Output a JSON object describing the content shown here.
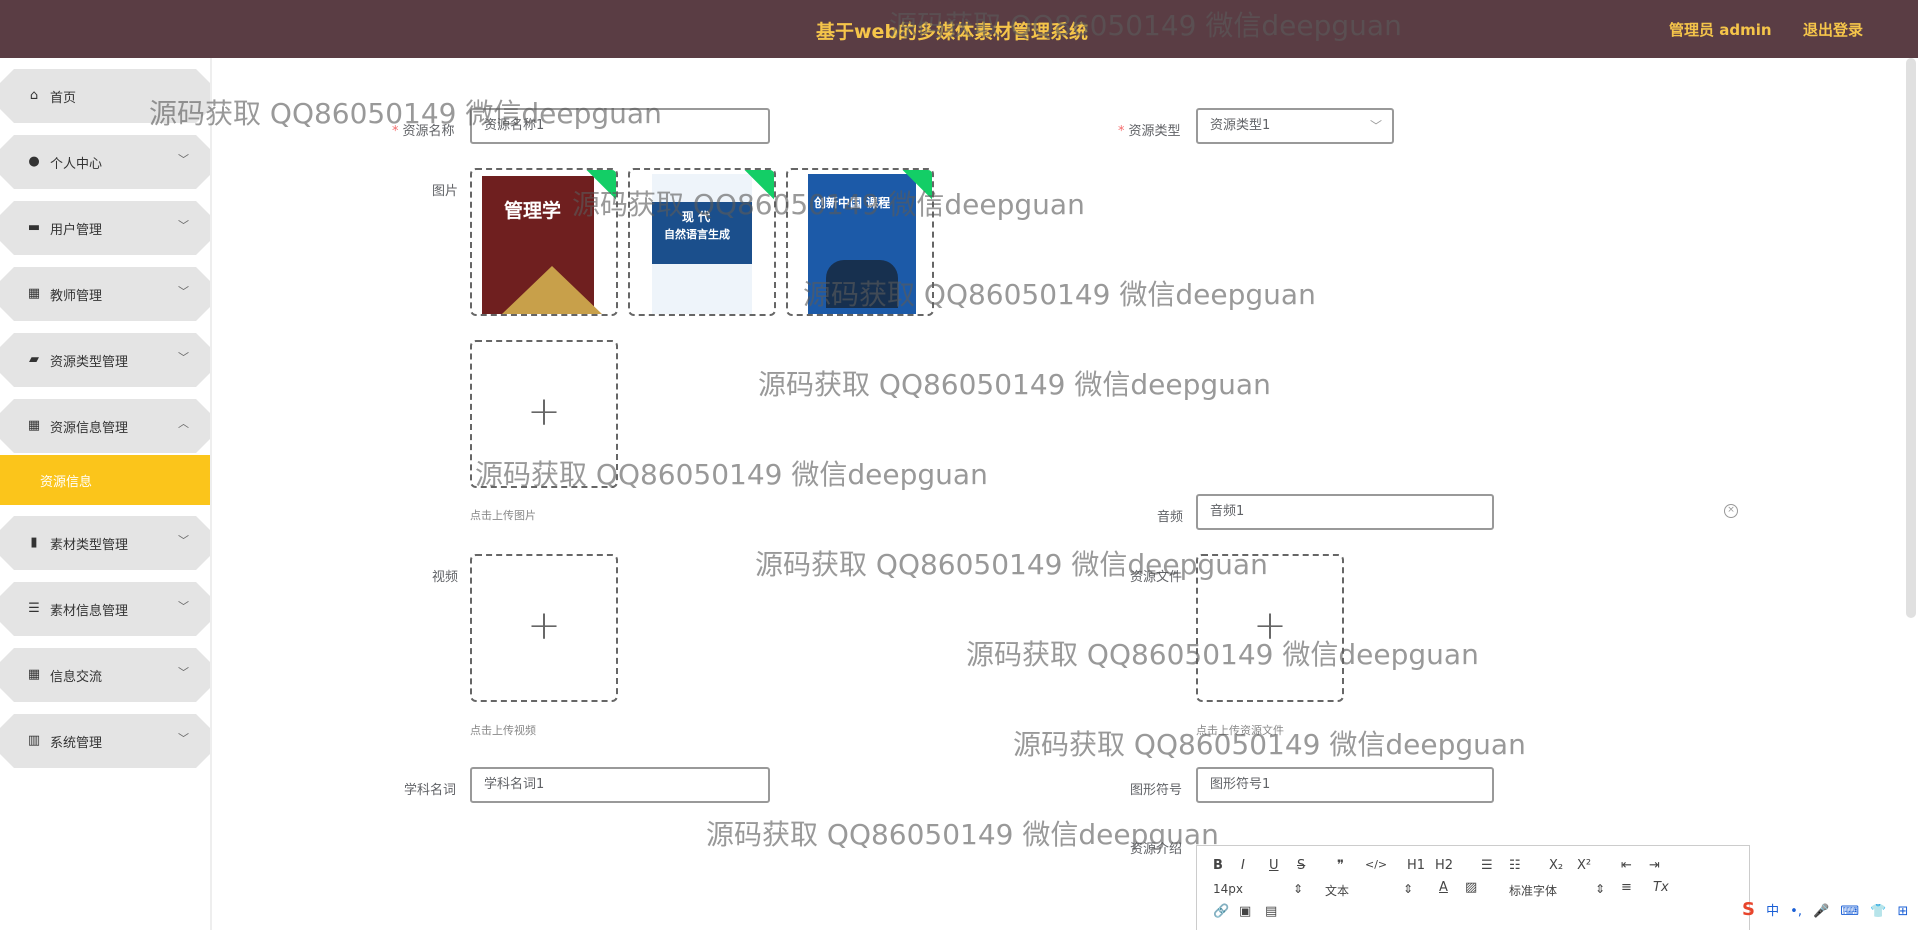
{
  "header": {
    "title": "基于web的多媒体素材管理系统",
    "user": "管理员 admin",
    "logout": "退出登录",
    "bg_color": "#5a3d44",
    "text_color": "#f5c54a"
  },
  "sidebar": {
    "items": [
      {
        "label": "首页",
        "icon": "home-icon"
      },
      {
        "label": "个人中心",
        "icon": "user-icon"
      },
      {
        "label": "用户管理",
        "icon": "chat-icon"
      },
      {
        "label": "教师管理",
        "icon": "grid-icon"
      },
      {
        "label": "资源类型管理",
        "icon": "briefcase-icon"
      },
      {
        "label": "资源信息管理",
        "icon": "grid-icon"
      },
      {
        "label": "素材类型管理",
        "icon": "bar-chart-icon"
      },
      {
        "label": "素材信息管理",
        "icon": "sliders-icon"
      },
      {
        "label": "信息交流",
        "icon": "grid-icon"
      },
      {
        "label": "系统管理",
        "icon": "library-icon"
      }
    ],
    "active_sub": "资源信息",
    "active_color": "#fbc51b"
  },
  "form": {
    "name_label": "资源名称",
    "name_value": "资源名称1",
    "type_label": "资源类型",
    "type_value": "资源类型1",
    "image_label": "图片",
    "images": [
      {
        "cover_title": "管理学"
      },
      {
        "cover_title_1": "现 代",
        "cover_title_2": "自然语言生成"
      },
      {
        "cover_title": "创新中国 课程"
      }
    ],
    "image_tip": "点击上传图片",
    "audio_label": "音频",
    "audio_value": "音频1",
    "video_label": "视频",
    "video_tip": "点击上传视频",
    "file_label": "资源文件",
    "file_tip": "点击上传资源文件",
    "subject_label": "学科名词",
    "subject_value": "学科名词1",
    "symbol_label": "图形符号",
    "symbol_value": "图形符号1",
    "intro_label": "资源介绍"
  },
  "editor": {
    "bold": "B",
    "italic": "I",
    "underline": "U",
    "strike": "S",
    "quote": "❞",
    "code": "</>",
    "h1": "H1",
    "h2": "H2",
    "ol": "☰",
    "ul": "☷",
    "sub": "X₂",
    "sup": "X²",
    "size": "14px",
    "format": "文本",
    "font": "标准字体"
  },
  "watermark": "源码获取 QQ86050149 微信deepguan",
  "ime": [
    "中",
    "•,",
    "🎤",
    "⌨",
    "👕",
    "⊞"
  ]
}
